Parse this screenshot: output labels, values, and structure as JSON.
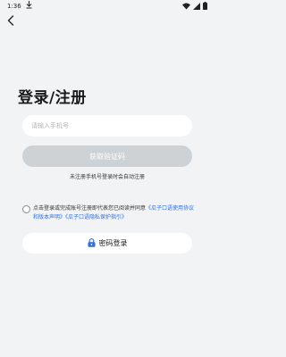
{
  "status_bar": {
    "time": "1:36",
    "icons": [
      "download-icon",
      "wifi-icon",
      "signal-icon",
      "battery-icon"
    ]
  },
  "page": {
    "title": "登录/注册",
    "back_icon": "chevron-left-icon"
  },
  "form": {
    "phone_placeholder": "请输入手机号",
    "phone_value": "",
    "get_code_label": "获取验证码",
    "hint": "未注册手机号登录时会自动注册"
  },
  "agreement": {
    "checked": false,
    "prefix": "点击登录或完成账号注册即代表您已阅读并同意",
    "link_terms": "《瓜子口语使用协议和版本声明》",
    "link_privacy": "《瓜子口语隐私保护指引》"
  },
  "password_login": {
    "label": "密码登录",
    "icon": "lock-icon"
  },
  "colors": {
    "background": "#f2f3f5",
    "disabled_button": "#cdd2d6",
    "link": "#2f6fe0",
    "lock_icon": "#2f6fe0"
  }
}
